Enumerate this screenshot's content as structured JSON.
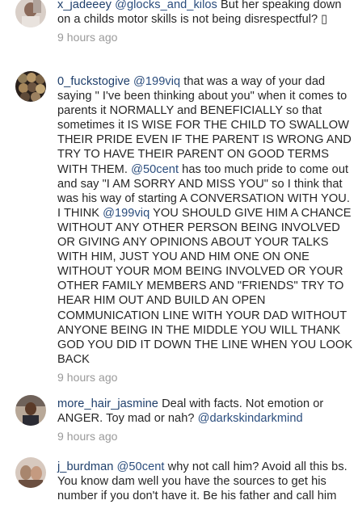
{
  "comments": [
    {
      "username": "x_jadeeey",
      "segments": [
        {
          "t": "mention",
          "v": "@glocks_and_kilos"
        },
        {
          "t": "text",
          "v": " But her speaking down on a childs motor skills is not being disrespectful? ▯"
        }
      ],
      "time": "9 hours ago",
      "avatar": "avatar-1"
    },
    {
      "username": "0_fuckstogive",
      "segments": [
        {
          "t": "mention",
          "v": "@199viq"
        },
        {
          "t": "text",
          "v": " that was a way of your dad saying \" I've been thinking about you\" when it comes to parents it NORMALLY and BENEFICIALLY so that sometimes it IS WISE FOR THE CHILD TO SWALLOW THEIR PRIDE EVEN IF THE PARENT IS WRONG AND TRY TO HAVE THEIR PARENT ON GOOD TERMS WITH THEM. "
        },
        {
          "t": "mention",
          "v": "@50cent"
        },
        {
          "t": "text",
          "v": " has too much pride to come out and say \"I AM SORRY AND MISS YOU\" so I think that was his way of starting A CONVERSATION WITH YOU. I THINK "
        },
        {
          "t": "mention",
          "v": "@199viq"
        },
        {
          "t": "text",
          "v": " YOU SHOULD GIVE HIM A CHANCE WITHOUT ANY OTHER PERSON BEING INVOLVED OR GIVING ANY OPINIONS ABOUT YOUR TALKS WITH HIM, JUST YOU AND HIM ONE ON ONE WITHOUT YOUR MOM BEING INVOLVED OR YOUR OTHER FAMILY MEMBERS AND \"FRIENDS\" TRY TO HEAR HIM OUT AND BUILD AN OPEN COMMUNICATION LINE WITH YOUR DAD WITHOUT ANYONE BEING IN THE MIDDLE YOU WILL THANK GOD YOU DID IT DOWN THE LINE WHEN YOU LOOK BACK"
        }
      ],
      "time": "9 hours ago",
      "avatar": "avatar-2"
    },
    {
      "username": "more_hair_jasmine",
      "segments": [
        {
          "t": "text",
          "v": " Deal with facts. Not emotion or ANGER. Toy mad or nah? "
        },
        {
          "t": "mention",
          "v": "@darkskindarkmind"
        }
      ],
      "time": "9 hours ago",
      "avatar": "avatar-3"
    },
    {
      "username": "j_burdman",
      "segments": [
        {
          "t": "mention",
          "v": "@50cent"
        },
        {
          "t": "text",
          "v": " why not call him? Avoid all this bs. You know dam well you have the sources to get his number if you don't have it. Be his father and call him"
        }
      ],
      "time": "",
      "avatar": "avatar-4"
    }
  ]
}
